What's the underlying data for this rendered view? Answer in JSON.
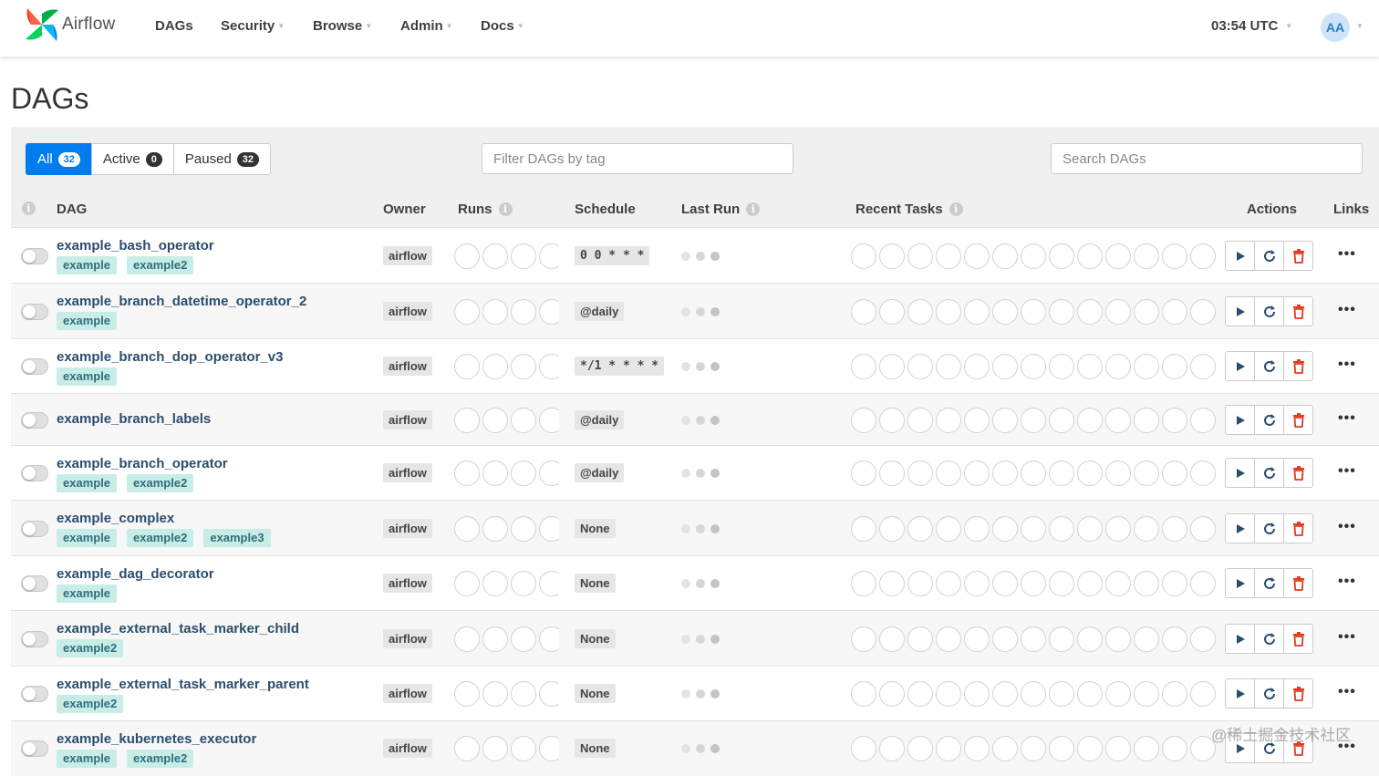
{
  "header": {
    "brand": "Airflow",
    "nav": [
      {
        "label": "DAGs",
        "dropdown": false,
        "icon": null
      },
      {
        "label": "Security",
        "dropdown": true,
        "icon": "caret-down-icon"
      },
      {
        "label": "Browse",
        "dropdown": true,
        "icon": "caret-down-icon"
      },
      {
        "label": "Admin",
        "dropdown": true,
        "icon": "caret-down-icon"
      },
      {
        "label": "Docs",
        "dropdown": true,
        "icon": "caret-down-icon"
      }
    ],
    "clock": "03:54 UTC",
    "avatar": "AA"
  },
  "page": {
    "title": "DAGs"
  },
  "filters": {
    "all": {
      "label": "All",
      "count": "32"
    },
    "active": {
      "label": "Active",
      "count": "0"
    },
    "paused": {
      "label": "Paused",
      "count": "32"
    }
  },
  "tag_filter": {
    "placeholder": "Filter DAGs by tag"
  },
  "search": {
    "placeholder": "Search DAGs"
  },
  "table": {
    "headers": {
      "dag": "DAG",
      "owner": "Owner",
      "runs": "Runs",
      "schedule": "Schedule",
      "last_run": "Last Run",
      "recent_tasks": "Recent Tasks",
      "actions": "Actions",
      "links": "Links"
    },
    "rows": [
      {
        "name": "example_bash_operator",
        "tags": [
          "example",
          "example2"
        ],
        "owner": "airflow",
        "schedule": "0 0 * * *"
      },
      {
        "name": "example_branch_datetime_operator_2",
        "tags": [
          "example"
        ],
        "owner": "airflow",
        "schedule": "@daily"
      },
      {
        "name": "example_branch_dop_operator_v3",
        "tags": [
          "example"
        ],
        "owner": "airflow",
        "schedule": "*/1 * * * *"
      },
      {
        "name": "example_branch_labels",
        "tags": [],
        "owner": "airflow",
        "schedule": "@daily"
      },
      {
        "name": "example_branch_operator",
        "tags": [
          "example",
          "example2"
        ],
        "owner": "airflow",
        "schedule": "@daily"
      },
      {
        "name": "example_complex",
        "tags": [
          "example",
          "example2",
          "example3"
        ],
        "owner": "airflow",
        "schedule": "None"
      },
      {
        "name": "example_dag_decorator",
        "tags": [
          "example"
        ],
        "owner": "airflow",
        "schedule": "None"
      },
      {
        "name": "example_external_task_marker_child",
        "tags": [
          "example2"
        ],
        "owner": "airflow",
        "schedule": "None"
      },
      {
        "name": "example_external_task_marker_parent",
        "tags": [
          "example2"
        ],
        "owner": "airflow",
        "schedule": "None"
      },
      {
        "name": "example_kubernetes_executor",
        "tags": [
          "example",
          "example2"
        ],
        "owner": "airflow",
        "schedule": "None"
      }
    ],
    "links_label": "•••"
  },
  "icons": {
    "trigger": "play-icon",
    "refresh": "refresh-icon",
    "delete": "trash-icon",
    "info": "info-icon"
  },
  "colors": {
    "accent": "#017cee",
    "dag_link": "#2b4d6e",
    "tag_bg": "#c8ede6",
    "delete": "#e43921"
  },
  "watermark": "@稀土掘金技术社区"
}
